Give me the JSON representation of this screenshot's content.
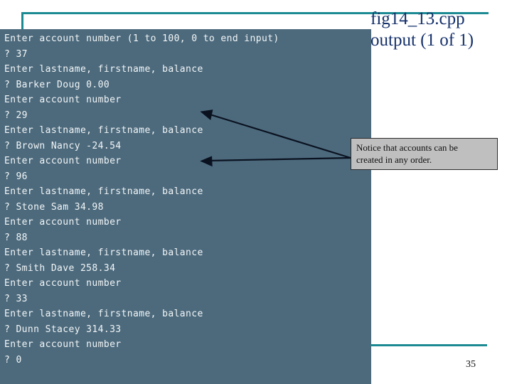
{
  "slide": {
    "page_number": "35",
    "accent_color": "#1b8a92",
    "title_color": "#16316b",
    "terminal_bg": "#4d6a7d",
    "terminal_fg": "#f2f6f7",
    "callout_bg": "#bfbfbf",
    "callout_border": "#2b2b2b",
    "arrow_color": "#0a1220"
  },
  "title": {
    "line1": "fig14_13.cpp",
    "line2": "output (1 of 1)"
  },
  "terminal": {
    "lines": [
      "Enter account number (1 to 100, 0 to end input)",
      "? 37",
      "Enter lastname, firstname, balance",
      "? Barker Doug 0.00",
      "Enter account number",
      "? 29",
      "Enter lastname, firstname, balance",
      "? Brown Nancy -24.54",
      "Enter account number",
      "? 96",
      "Enter lastname, firstname, balance",
      "? Stone Sam 34.98",
      "Enter account number",
      "? 88",
      "Enter lastname, firstname, balance",
      "? Smith Dave 258.34",
      "Enter account number",
      "? 33",
      "Enter lastname, firstname, balance",
      "? Dunn Stacey 314.33",
      "Enter account number",
      "? 0"
    ]
  },
  "callout": {
    "line1": "Notice that accounts can be",
    "line2": "created in any order."
  }
}
